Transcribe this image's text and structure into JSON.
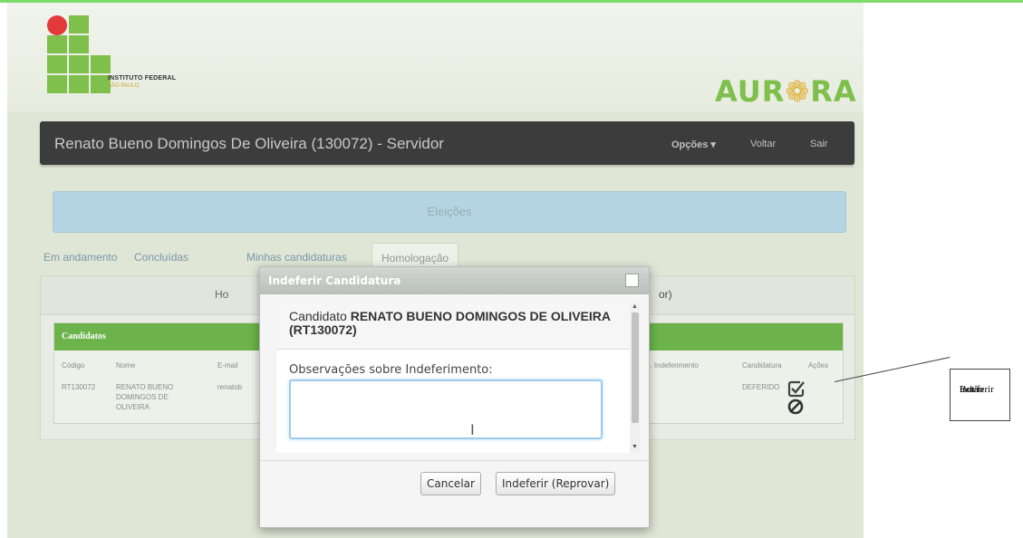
{
  "logo": {
    "line1": "INSTITUTO FEDERAL",
    "line2": "SÃO PAULO"
  },
  "brand": {
    "left": "AUR",
    "flower": "❁",
    "right": "RA"
  },
  "navbar": {
    "title": "Renato Bueno Domingos De Oliveira (130072) - Servidor",
    "options_label": "Opções ▾",
    "back_label": "Voltar",
    "exit_label": "Sair"
  },
  "elections_header": "Eleições",
  "tabs": [
    {
      "label": "Em andamento"
    },
    {
      "label": "Concluídas"
    },
    {
      "label": "Minhas candidaturas"
    },
    {
      "label": "Homologação"
    }
  ],
  "panel": {
    "title_left": "Ho",
    "title_right": "or)"
  },
  "candidates_table": {
    "title": "Candidatos",
    "columns": [
      "Código",
      "Nome",
      "E-mail",
      "bs. Indeferimento",
      "Candidatura",
      "Ações"
    ],
    "rows": [
      {
        "codigo": "RT130072",
        "nome": "RENATO BUENO DOMINGOS DE OLIVEIRA",
        "email": "renatob",
        "candidatura": "DEFERIDO"
      }
    ]
  },
  "modal": {
    "title": "Indeferir Candidatura",
    "candidate_prefix": "Candidato",
    "candidate_name": "RENATO BUENO DOMINGOS DE OLIVEIRA (RT130072)",
    "obs_label": "Observações sobre Indeferimento:",
    "obs_value": "",
    "cancel_label": "Cancelar",
    "reject_label": "Indeferir (Reprovar)"
  },
  "annotation": {
    "line1": "Botão",
    "line2": "indeferir"
  },
  "colors": {
    "navbar": "#3c3c3c",
    "table_header": "#6bb34a",
    "elections_bar": "#b5d4e2",
    "input_focus": "#9ecbe8"
  }
}
